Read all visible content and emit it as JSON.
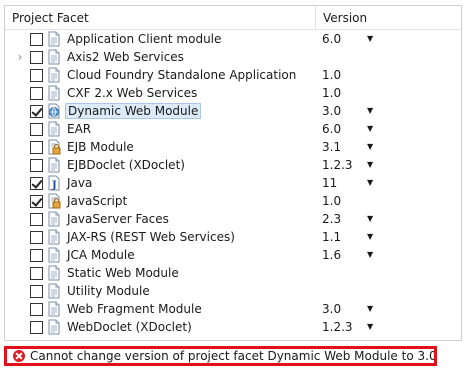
{
  "header": {
    "facet_label": "Project Facet",
    "version_label": "Version"
  },
  "rows": [
    {
      "label": "Application Client module",
      "version": "6.0",
      "checked": false,
      "has_dropdown": true,
      "icon": "doc-icon"
    },
    {
      "label": "Axis2 Web Services",
      "version": "",
      "checked": false,
      "has_dropdown": false,
      "icon": "doc-icon",
      "expandable": true
    },
    {
      "label": "Cloud Foundry Standalone Application",
      "version": "1.0",
      "checked": false,
      "has_dropdown": false,
      "icon": "doc-icon"
    },
    {
      "label": "CXF 2.x Web Services",
      "version": "1.0",
      "checked": false,
      "has_dropdown": false,
      "icon": "doc-icon"
    },
    {
      "label": "Dynamic Web Module",
      "version": "3.0",
      "checked": true,
      "has_dropdown": true,
      "icon": "globe-icon",
      "selected": true
    },
    {
      "label": "EAR",
      "version": "6.0",
      "checked": false,
      "has_dropdown": true,
      "icon": "doc-icon"
    },
    {
      "label": "EJB Module",
      "version": "3.1",
      "checked": false,
      "has_dropdown": true,
      "icon": "lock-doc-icon"
    },
    {
      "label": "EJBDoclet (XDoclet)",
      "version": "1.2.3",
      "checked": false,
      "has_dropdown": true,
      "icon": "doc-icon"
    },
    {
      "label": "Java",
      "version": "11",
      "checked": true,
      "has_dropdown": true,
      "icon": "java-icon"
    },
    {
      "label": "JavaScript",
      "version": "1.0",
      "checked": true,
      "has_dropdown": false,
      "icon": "lock-doc-icon"
    },
    {
      "label": "JavaServer Faces",
      "version": "2.3",
      "checked": false,
      "has_dropdown": true,
      "icon": "doc-icon"
    },
    {
      "label": "JAX-RS (REST Web Services)",
      "version": "1.1",
      "checked": false,
      "has_dropdown": true,
      "icon": "doc-icon"
    },
    {
      "label": "JCA Module",
      "version": "1.6",
      "checked": false,
      "has_dropdown": true,
      "icon": "doc-icon"
    },
    {
      "label": "Static Web Module",
      "version": "",
      "checked": false,
      "has_dropdown": false,
      "icon": "doc-icon"
    },
    {
      "label": "Utility Module",
      "version": "",
      "checked": false,
      "has_dropdown": false,
      "icon": "doc-icon"
    },
    {
      "label": "Web Fragment Module",
      "version": "3.0",
      "checked": false,
      "has_dropdown": true,
      "icon": "doc-icon"
    },
    {
      "label": "WebDoclet (XDoclet)",
      "version": "1.2.3",
      "checked": false,
      "has_dropdown": true,
      "icon": "doc-icon"
    }
  ],
  "status": {
    "message": "Cannot change version of project facet Dynamic Web Module to 3.0."
  },
  "colors": {
    "error_border": "#e0111b",
    "selection_bg": "#ddeaf8",
    "selection_border": "#a9c7ec"
  }
}
